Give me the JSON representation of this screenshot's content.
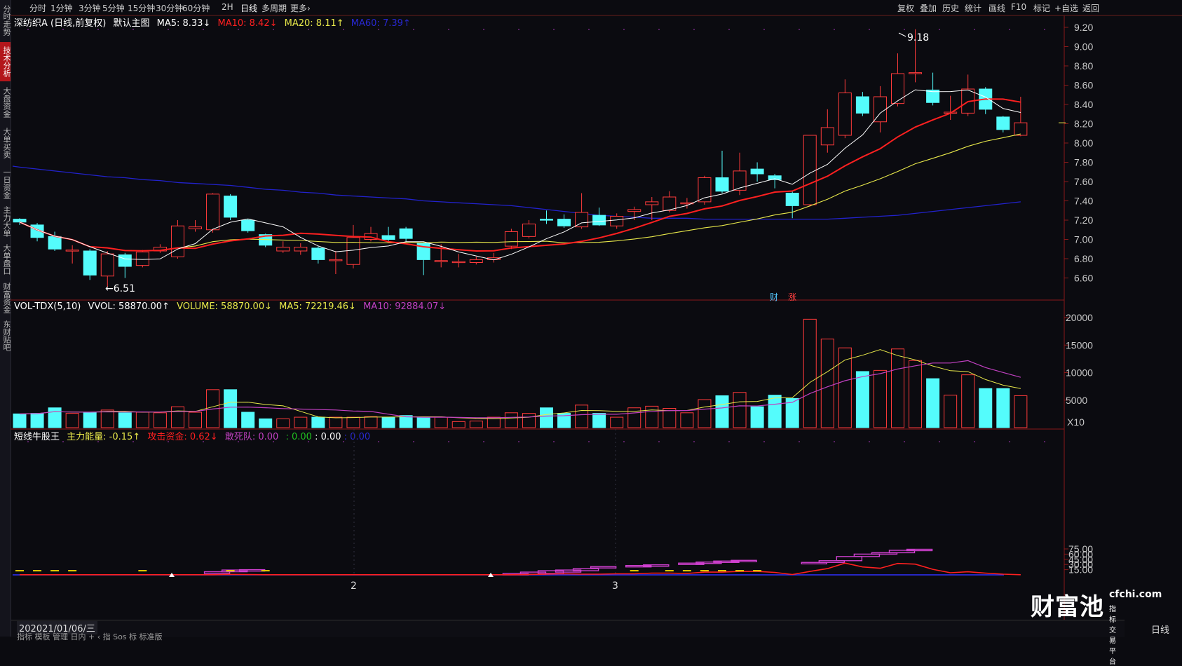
{
  "sidebar": {
    "items": [
      "分时走势",
      "技术分析",
      "大盘资金",
      "大单买卖",
      "一日资金",
      "主力大单",
      "大单盘口",
      "财富资金",
      "东财贴吧"
    ],
    "active_index": 1
  },
  "toolbar": {
    "periods": [
      "分时",
      "1分钟",
      "3分钟",
      "5分钟",
      "15分钟",
      "30分钟",
      "60分钟",
      "2H",
      "日线",
      "多周期",
      "更多›"
    ],
    "active_period": "日线",
    "right_buttons": [
      "复权",
      "叠加",
      "历史",
      "统计",
      "画线",
      "F10",
      "标记",
      "+自选",
      "返回"
    ]
  },
  "main_legend": {
    "name": "深纺织A (日线,前复权)",
    "template": "默认主图",
    "ma5": "MA5: 8.33↓",
    "ma10": "MA10: 8.42↓",
    "ma20": "MA20: 8.11↑",
    "ma60": "MA60: 7.39↑"
  },
  "vol_legend": {
    "name": "VOL-TDX(5,10)",
    "vvol": "VVOL: 58870.00↑",
    "volume": "VOLUME: 58870.00↓",
    "ma5": "MA5: 72219.46↓",
    "ma10": "MA10: 92884.07↓"
  },
  "ind_legend": {
    "name": "短线牛股王",
    "zl": "主力能量: -0.15↑",
    "gj": "攻击资金: 0.62↓",
    "gsd": "敢死队: 0.00",
    "g1": ": 0.00",
    "g2": ": 0.00",
    "g3": ": 0.00"
  },
  "colors": {
    "up": "#ff3b3b",
    "down": "#54fcfc",
    "ma5": "#ffffff",
    "ma10": "#ff2020",
    "ma20": "#e8e84a",
    "ma60": "#2222cc",
    "vma10": "#c040c0",
    "bg": "#0b0b10"
  },
  "price_axis": {
    "ticks": [
      "9.20",
      "9.00",
      "8.80",
      "8.60",
      "8.40",
      "8.20",
      "8.00",
      "7.80",
      "7.60",
      "7.40",
      "7.20",
      "7.00",
      "6.80",
      "6.60"
    ]
  },
  "vol_axis": {
    "ticks": [
      "20000",
      "15000",
      "10000",
      "5000"
    ],
    "unit": "X10"
  },
  "ind_axis": {
    "ticks": [
      "75.00",
      "60.00",
      "45.00",
      "30.00",
      "15.00"
    ]
  },
  "annotations": {
    "high": "9.18",
    "low": "←6.51",
    "tag1": "财",
    "tag2": "涨"
  },
  "x_labels": {
    "date": "2021/01/06/三",
    "date_prefix": "20",
    "m2": "2",
    "m3": "3"
  },
  "bottom_tabs": "指标  模板  管理  日内 +  ‹ 指 Sos 标  标准版",
  "period_button": "日线",
  "watermark": {
    "brand": "财富池",
    "url": "cfchi.com",
    "sub": "指标交易平台"
  },
  "chart_data": {
    "type": "candlestick",
    "candles": [
      {
        "o": 7.21,
        "c": 7.18,
        "h": 7.22,
        "l": 7.15
      },
      {
        "o": 7.15,
        "c": 7.02,
        "h": 7.17,
        "l": 6.98
      },
      {
        "o": 7.03,
        "c": 6.9,
        "h": 7.08,
        "l": 6.88
      },
      {
        "o": 6.88,
        "c": 6.89,
        "h": 6.94,
        "l": 6.75
      },
      {
        "o": 6.88,
        "c": 6.63,
        "h": 6.9,
        "l": 6.58
      },
      {
        "o": 6.62,
        "c": 6.85,
        "h": 6.88,
        "l": 6.51
      },
      {
        "o": 6.84,
        "c": 6.72,
        "h": 6.86,
        "l": 6.6
      },
      {
        "o": 6.73,
        "c": 6.87,
        "h": 6.89,
        "l": 6.71
      },
      {
        "o": 6.88,
        "c": 6.92,
        "h": 6.95,
        "l": 6.86
      },
      {
        "o": 6.82,
        "c": 7.14,
        "h": 7.2,
        "l": 6.8
      },
      {
        "o": 7.11,
        "c": 7.13,
        "h": 7.2,
        "l": 7.08
      },
      {
        "o": 7.1,
        "c": 7.47,
        "h": 7.48,
        "l": 7.07
      },
      {
        "o": 7.45,
        "c": 7.23,
        "h": 7.47,
        "l": 7.2
      },
      {
        "o": 7.2,
        "c": 7.09,
        "h": 7.21,
        "l": 7.07
      },
      {
        "o": 7.05,
        "c": 6.94,
        "h": 7.06,
        "l": 6.92
      },
      {
        "o": 6.88,
        "c": 6.92,
        "h": 6.98,
        "l": 6.86
      },
      {
        "o": 6.88,
        "c": 6.92,
        "h": 6.96,
        "l": 6.84
      },
      {
        "o": 6.91,
        "c": 6.79,
        "h": 6.93,
        "l": 6.75
      },
      {
        "o": 6.78,
        "c": 6.79,
        "h": 6.88,
        "l": 6.64
      },
      {
        "o": 6.74,
        "c": 7.02,
        "h": 7.15,
        "l": 6.7
      },
      {
        "o": 7.0,
        "c": 7.06,
        "h": 7.13,
        "l": 6.98
      },
      {
        "o": 7.04,
        "c": 7.0,
        "h": 7.13,
        "l": 6.97
      },
      {
        "o": 7.11,
        "c": 7.01,
        "h": 7.13,
        "l": 6.98
      },
      {
        "o": 6.96,
        "c": 6.79,
        "h": 6.97,
        "l": 6.63
      },
      {
        "o": 6.77,
        "c": 6.78,
        "h": 6.95,
        "l": 6.71
      },
      {
        "o": 6.77,
        "c": 6.77,
        "h": 6.85,
        "l": 6.71
      },
      {
        "o": 6.76,
        "c": 6.79,
        "h": 6.82,
        "l": 6.74
      },
      {
        "o": 6.79,
        "c": 6.81,
        "h": 6.86,
        "l": 6.76
      },
      {
        "o": 6.93,
        "c": 7.08,
        "h": 7.11,
        "l": 6.9
      },
      {
        "o": 7.03,
        "c": 7.16,
        "h": 7.2,
        "l": 7.01
      },
      {
        "o": 7.21,
        "c": 7.2,
        "h": 7.3,
        "l": 7.16
      },
      {
        "o": 7.21,
        "c": 7.14,
        "h": 7.26,
        "l": 7.12
      },
      {
        "o": 7.13,
        "c": 7.28,
        "h": 7.48,
        "l": 7.11
      },
      {
        "o": 7.25,
        "c": 7.15,
        "h": 7.33,
        "l": 7.14
      },
      {
        "o": 7.14,
        "c": 7.24,
        "h": 7.27,
        "l": 7.11
      },
      {
        "o": 7.29,
        "c": 7.31,
        "h": 7.34,
        "l": 7.2
      },
      {
        "o": 7.36,
        "c": 7.39,
        "h": 7.44,
        "l": 7.2
      },
      {
        "o": 7.3,
        "c": 7.44,
        "h": 7.5,
        "l": 7.28
      },
      {
        "o": 7.38,
        "c": 7.38,
        "h": 7.43,
        "l": 7.32
      },
      {
        "o": 7.39,
        "c": 7.64,
        "h": 7.66,
        "l": 7.36
      },
      {
        "o": 7.64,
        "c": 7.5,
        "h": 7.92,
        "l": 7.48
      },
      {
        "o": 7.51,
        "c": 7.71,
        "h": 7.9,
        "l": 7.46
      },
      {
        "o": 7.73,
        "c": 7.68,
        "h": 7.8,
        "l": 7.6
      },
      {
        "o": 7.66,
        "c": 7.62,
        "h": 7.68,
        "l": 7.53
      },
      {
        "o": 7.48,
        "c": 7.35,
        "h": 7.5,
        "l": 7.22
      },
      {
        "o": 7.36,
        "c": 8.08,
        "h": 8.08,
        "l": 7.34
      },
      {
        "o": 7.98,
        "c": 8.16,
        "h": 8.35,
        "l": 7.9
      },
      {
        "o": 8.08,
        "c": 8.52,
        "h": 8.66,
        "l": 8.05
      },
      {
        "o": 8.48,
        "c": 8.31,
        "h": 8.53,
        "l": 8.28
      },
      {
        "o": 8.22,
        "c": 8.48,
        "h": 8.59,
        "l": 8.11
      },
      {
        "o": 8.41,
        "c": 8.72,
        "h": 8.93,
        "l": 8.38
      },
      {
        "o": 8.73,
        "c": 8.73,
        "h": 9.18,
        "l": 8.63
      },
      {
        "o": 8.55,
        "c": 8.42,
        "h": 8.73,
        "l": 8.39
      },
      {
        "o": 8.32,
        "c": 8.32,
        "h": 8.49,
        "l": 8.24
      },
      {
        "o": 8.31,
        "c": 8.56,
        "h": 8.71,
        "l": 8.28
      },
      {
        "o": 8.56,
        "c": 8.35,
        "h": 8.58,
        "l": 8.3
      },
      {
        "o": 8.27,
        "c": 8.14,
        "h": 8.28,
        "l": 8.11
      },
      {
        "o": 8.08,
        "c": 8.21,
        "h": 8.48,
        "l": 8.07
      }
    ],
    "volume": [
      2500,
      2600,
      3600,
      2600,
      2800,
      3200,
      2700,
      2800,
      2700,
      3800,
      2800,
      6900,
      6900,
      2800,
      1600,
      1600,
      1900,
      1900,
      1900,
      1900,
      2000,
      1900,
      2200,
      1900,
      1900,
      1100,
      1200,
      1900,
      2700,
      2600,
      3600,
      2600,
      4100,
      2600,
      1900,
      3600,
      3900,
      3500,
      2700,
      5100,
      5800,
      6400,
      3800,
      5900,
      5300,
      19700,
      16100,
      14500,
      10200,
      10400,
      14300,
      12200,
      8900,
      5900,
      9600,
      7100,
      7100,
      5800
    ],
    "ma60": [
      7.75,
      7.73,
      7.71,
      7.69,
      7.67,
      7.65,
      7.64,
      7.62,
      7.61,
      7.59,
      7.58,
      7.57,
      7.56,
      7.54,
      7.52,
      7.51,
      7.49,
      7.48,
      7.46,
      7.45,
      7.44,
      7.43,
      7.42,
      7.4,
      7.39,
      7.38,
      7.37,
      7.36,
      7.35,
      7.33,
      7.31,
      7.29,
      7.27,
      7.25,
      7.24,
      7.23,
      7.22,
      7.22,
      7.22,
      7.21,
      7.21,
      7.21,
      7.21,
      7.21,
      7.21,
      7.21,
      7.21,
      7.22,
      7.23,
      7.24,
      7.25,
      7.27,
      7.29,
      7.31,
      7.33,
      7.35,
      7.37,
      7.39
    ],
    "ind_line": [
      0.5,
      0.5,
      0.5,
      0.5,
      0.5,
      0.5,
      0.5,
      0.5,
      0.5,
      0.5,
      0.5,
      0.5,
      1.5,
      0.8,
      0.5,
      0.5,
      0.5,
      0.5,
      0.5,
      0.5,
      0.5,
      0.5,
      0.5,
      0.5,
      0.5,
      0.5,
      0.5,
      0.5,
      0.5,
      1.0,
      2.0,
      3.0,
      2.0,
      2.0,
      3.0,
      3.0,
      5.0,
      5.0,
      4.0,
      8.0,
      8.0,
      10.0,
      10.0,
      7.0,
      1.0,
      10.0,
      18.0,
      34.0,
      23.0,
      19.0,
      33.0,
      31.0,
      16.0,
      6.0,
      9.0,
      5.0,
      2.0,
      0.5
    ],
    "staircase": [
      [
        11,
        4,
        9
      ],
      [
        12,
        9,
        14
      ],
      [
        13,
        11,
        15
      ],
      [
        28,
        1,
        4
      ],
      [
        29,
        2,
        8
      ],
      [
        30,
        4,
        12
      ],
      [
        31,
        8,
        14
      ],
      [
        32,
        12,
        18
      ],
      [
        33,
        20,
        24
      ],
      [
        35,
        24,
        27
      ],
      [
        36,
        26,
        29
      ],
      [
        38,
        30,
        34
      ],
      [
        39,
        33,
        37
      ],
      [
        40,
        36,
        40
      ],
      [
        41,
        38,
        42
      ],
      [
        45,
        34,
        36
      ],
      [
        46,
        36,
        41
      ],
      [
        47,
        41,
        53
      ],
      [
        48,
        53,
        60
      ],
      [
        49,
        60,
        64
      ],
      [
        50,
        64,
        71
      ],
      [
        51,
        70,
        74
      ]
    ],
    "ind_dash": [
      0,
      1,
      2,
      3,
      7,
      12,
      14,
      35,
      37,
      38,
      39,
      40,
      41,
      42
    ]
  }
}
